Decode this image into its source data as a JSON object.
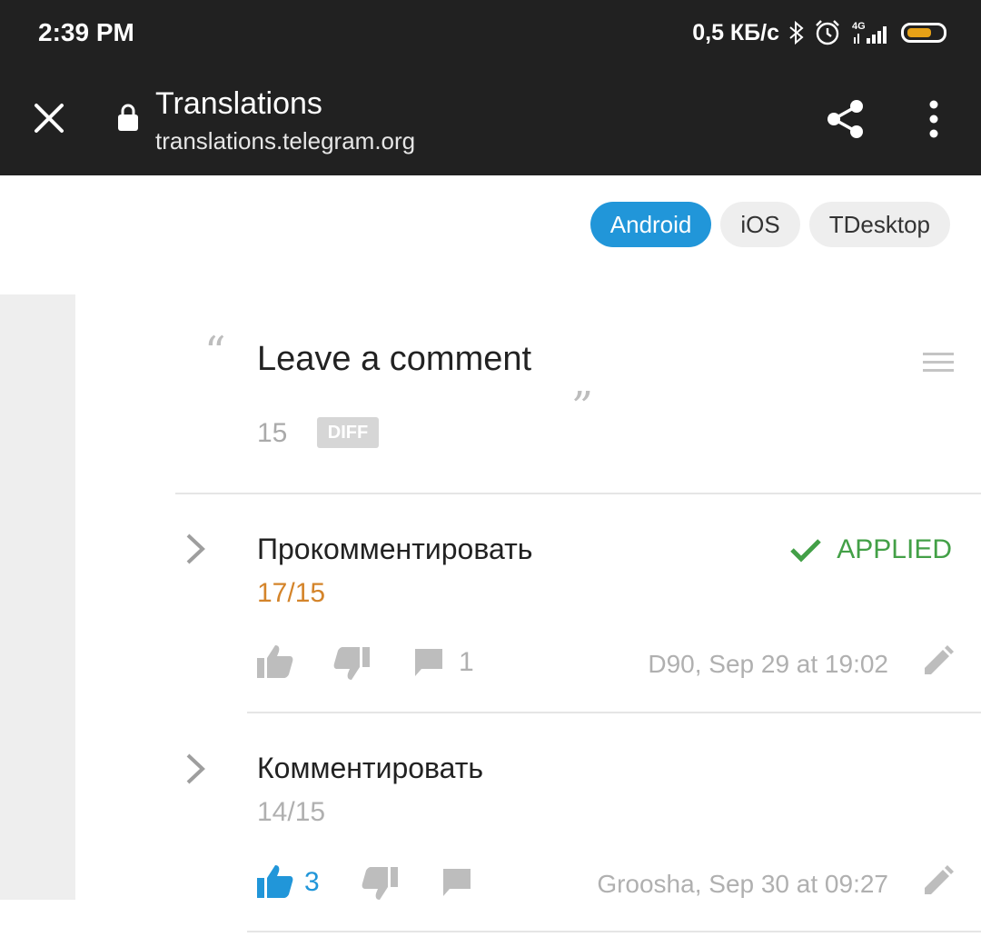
{
  "status_bar": {
    "time": "2:39 PM",
    "net_speed": "0,5 КБ/с",
    "network_type": "4G",
    "icons": [
      "bluetooth-icon",
      "alarm-icon",
      "signal-icon",
      "battery-icon"
    ]
  },
  "browser": {
    "title": "Translations",
    "url": "translations.telegram.org",
    "icons": [
      "close-icon",
      "lock-icon",
      "share-icon",
      "more-icon"
    ]
  },
  "platform_tabs": [
    {
      "label": "Android",
      "active": true
    },
    {
      "label": "iOS",
      "active": false
    },
    {
      "label": "TDesktop",
      "active": false
    }
  ],
  "source": {
    "quote_open": "“",
    "text": "Leave a comment",
    "quote_close": "„",
    "char_count": "15",
    "diff_label": "DIFF"
  },
  "translations": [
    {
      "text": "Прокомментировать",
      "count": "17/15",
      "count_color": "#d4842a",
      "status": "APPLIED",
      "likes": "",
      "comments": "1",
      "meta": "D90, Sep 29 at 19:02"
    },
    {
      "text": "Комментировать",
      "count": "14/15",
      "count_color": "#b0b0b0",
      "status": "",
      "likes": "3",
      "comments": "",
      "meta": "Groosha, Sep 30 at 09:27"
    }
  ],
  "colors": {
    "topbar": "#212121",
    "accent": "#2196d9",
    "applied": "#43a047",
    "muted": "#b0b0b0"
  }
}
